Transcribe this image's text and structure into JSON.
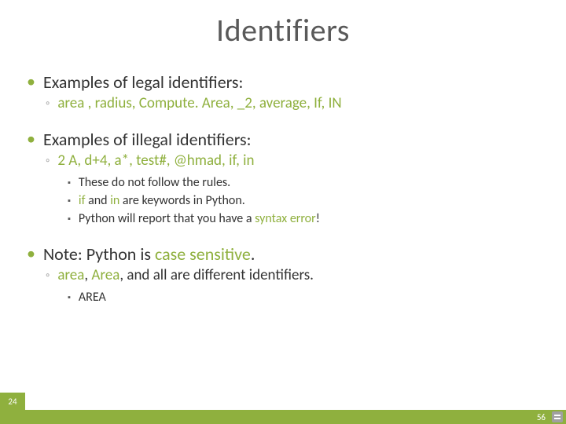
{
  "title": "Identifiers",
  "content": {
    "b1": {
      "text": "Examples of legal identifiers:",
      "sub": "area , radius, Compute. Area, _2, average, If, IN"
    },
    "b2": {
      "text": "Examples of illegal identifiers:",
      "sub": "2 A, d+4, a*, test#, @hmad, if, in",
      "sub2a": "These do not follow the rules.",
      "sub2b_pre": "if",
      "sub2b_mid": " and ",
      "sub2b_in": "in",
      "sub2b_post": " are keywords in Python.",
      "sub2c_pre": "Python will report that you have a ",
      "sub2c_err": "syntax error",
      "sub2c_post": "!"
    },
    "b3": {
      "pre": "Note: Python is ",
      "cs": "case sensitive",
      "post": ".",
      "sub_pre": "area",
      "sub_mid": ", ",
      "sub_Area": "Area",
      "sub_post": ", and all are different identifiers.",
      "sub2": "AREA"
    }
  },
  "pageLeft": "24",
  "pageRight": "56"
}
